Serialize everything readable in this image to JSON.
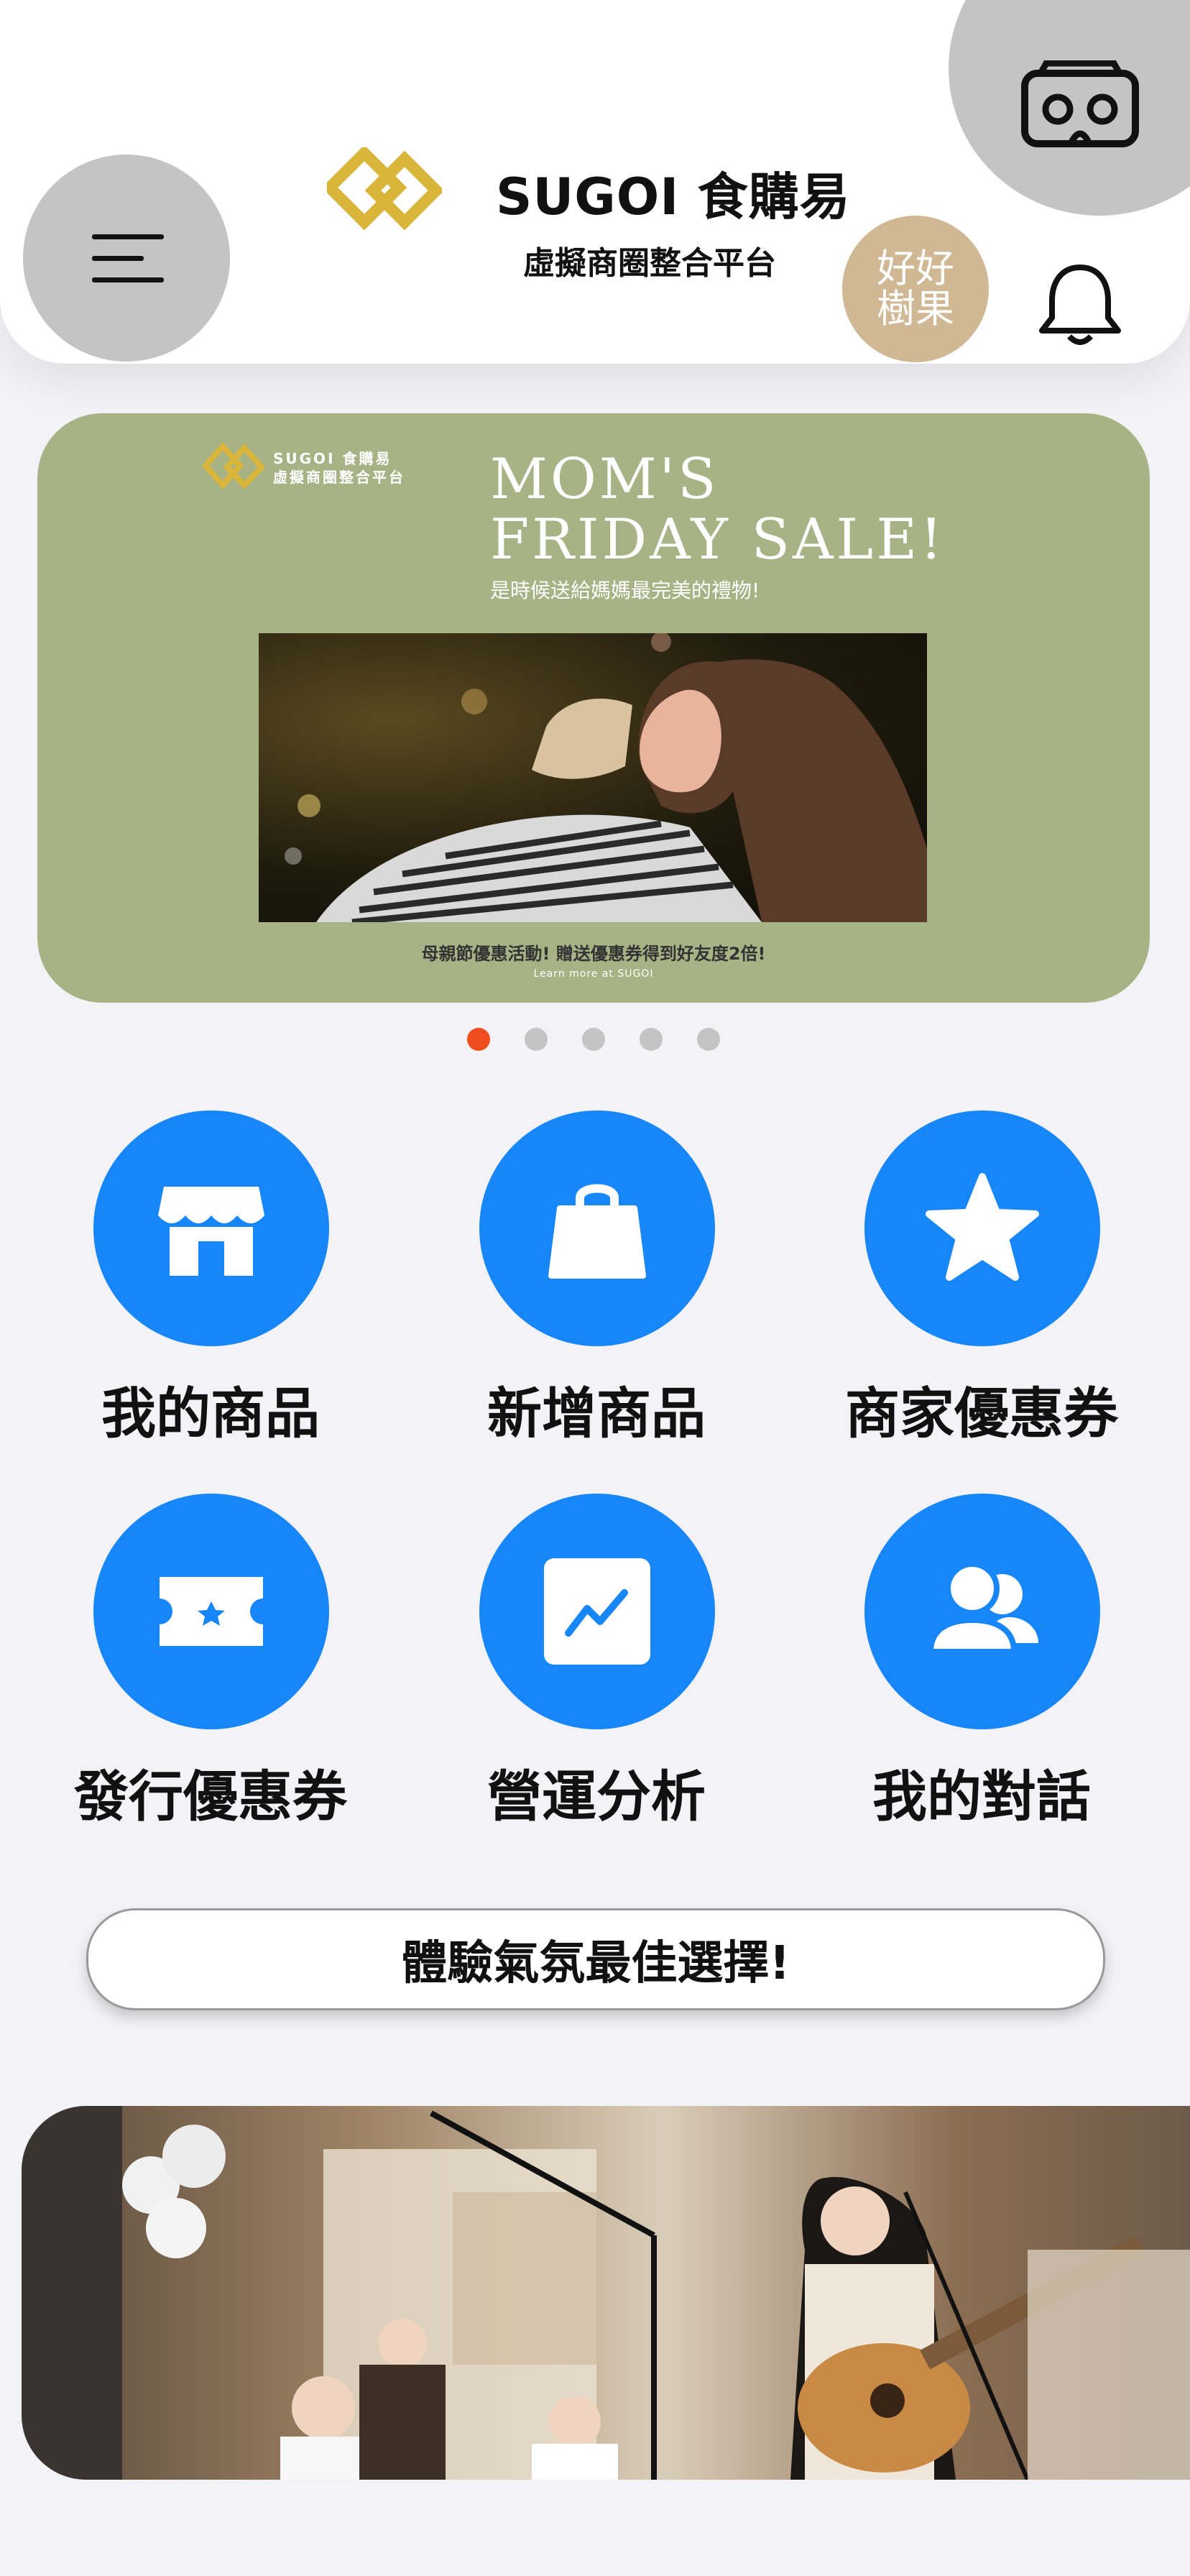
{
  "header": {
    "brand_title": "SUGOI 食購易",
    "brand_subtitle": "虛擬商圈整合平台",
    "shop_avatar_text": "好好樹果",
    "icons": [
      "vr-headset-icon",
      "menu-icon",
      "bell-icon"
    ]
  },
  "banner": {
    "brand_line1": "SUGOI  食購易",
    "brand_line2": "虛擬商圈整合平台",
    "title_line1": "MOM'S",
    "title_line2": "FRIDAY SALE!",
    "subtitle": "是時候送給媽媽最完美的禮物!",
    "footer": "母親節優惠活動! 贈送優惠券得到好友度2倍!",
    "footer_small": "Learn more at SUGOI"
  },
  "carousel": {
    "total": 5,
    "active_index": 0
  },
  "features": [
    {
      "label": "我的商品",
      "icon": "store-icon"
    },
    {
      "label": "新增商品",
      "icon": "shopping-bag-icon"
    },
    {
      "label": "商家優惠券",
      "icon": "star-icon"
    },
    {
      "label": "發行優惠券",
      "icon": "ticket-icon"
    },
    {
      "label": "營運分析",
      "icon": "analytics-icon"
    },
    {
      "label": "我的對話",
      "icon": "users-icon"
    }
  ],
  "cta_label": "體驗氣氛最佳選擇!",
  "colors": {
    "accent_blue": "#1786f8",
    "active_dot": "#f04d1f",
    "banner_green": "#a8b385",
    "gold": "#d9b53a"
  }
}
